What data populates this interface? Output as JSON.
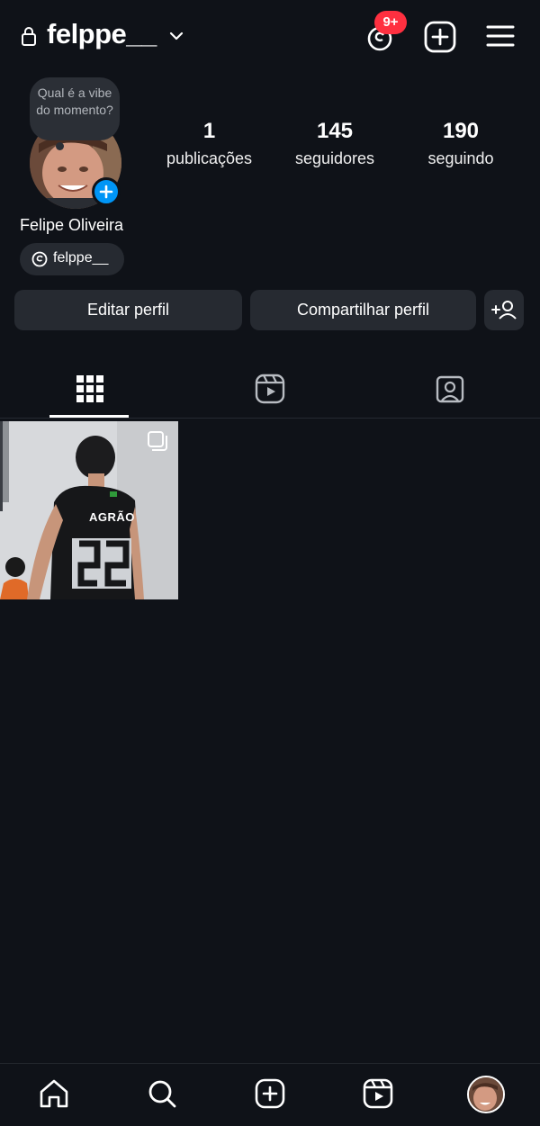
{
  "header": {
    "username": "felppe__",
    "notifications_badge": "9+",
    "badge_color": "#ff3040"
  },
  "profile": {
    "note_text": "Qual é a vibe do momento?",
    "full_name": "Felipe Oliveira",
    "threads_handle": "felppe__",
    "stats": [
      {
        "value": "1",
        "label": "publicações"
      },
      {
        "value": "145",
        "label": "seguidores"
      },
      {
        "value": "190",
        "label": "seguindo"
      }
    ],
    "accent_color": "#0095f6"
  },
  "actions": {
    "edit_label": "Editar perfil",
    "share_label": "Compartilhar perfil"
  },
  "tabs": [
    {
      "name": "grid-icon",
      "active": true
    },
    {
      "name": "reels-icon",
      "active": false
    },
    {
      "name": "tagged-icon",
      "active": false
    }
  ],
  "posts": [
    {
      "jersey_text": "AGRÃO",
      "multiple": true
    }
  ],
  "bottom_nav": [
    "home-icon",
    "search-icon",
    "create-icon",
    "reels-icon",
    "profile-avatar"
  ]
}
